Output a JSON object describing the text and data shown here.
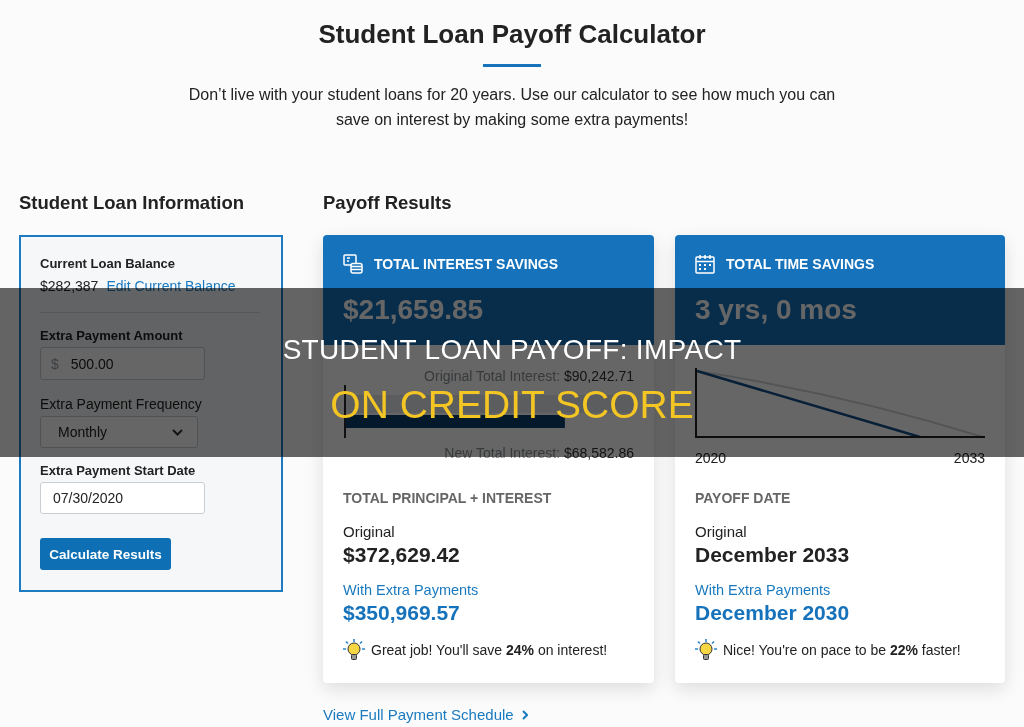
{
  "header": {
    "title": "Student Loan Payoff Calculator",
    "subtitle": "Don’t live with your student loans for 20 years. Use our calculator to see how much you can save on interest by making some extra payments!"
  },
  "loan_info": {
    "heading": "Student Loan Information",
    "balance": {
      "label": "Current Loan Balance",
      "value": "$282,387",
      "link": "Edit Current Balance"
    },
    "fields": [
      {
        "kind": "currency",
        "label": "Extra Payment Amount",
        "prefix": "$",
        "value": "500.00"
      },
      {
        "kind": "select",
        "label": "Extra Payment Frequency",
        "value": "Monthly"
      },
      {
        "kind": "date",
        "label": "Extra Payment Start Date",
        "value": "07/30/2020"
      }
    ],
    "button": "Calculate Results"
  },
  "results": {
    "heading": "Payoff Results",
    "cards": [
      {
        "kind": "interest",
        "title": "TOTAL INTEREST SAVINGS",
        "value": "$21,659.85",
        "bars": [
          {
            "kind": "original",
            "label": "Original Total Interest:",
            "amount": "$90,242.71",
            "level": 1
          },
          {
            "kind": "new",
            "label": "New Total Interest:",
            "amount": "$68,582.86",
            "level": 0.76
          }
        ],
        "summary": {
          "heading": "TOTAL PRINCIPAL + INTEREST",
          "original_label": "Original",
          "original_value": "$372,629.42",
          "extra_label": "With Extra Payments",
          "extra_value": "$350,969.57",
          "tip": "Great job! You'll save **24%** on interest!"
        }
      },
      {
        "kind": "time",
        "title": "TOTAL TIME SAVINGS",
        "value": "3 yrs, 0 mos",
        "axis_labels": [
          "2020",
          "2033"
        ],
        "summary": {
          "heading": "PAYOFF DATE",
          "original_label": "Original",
          "original_value": "December 2033",
          "extra_label": "With Extra Payments",
          "extra_value": "December 2030",
          "tip": "Nice! You're on pace to be **22%** faster!"
        }
      }
    ],
    "link": "View Full Payment Schedule"
  },
  "banner": {
    "line_1": "STUDENT LOAN PAYOFF: IMPACT",
    "line_2": "ON CREDIT SCORE"
  }
}
